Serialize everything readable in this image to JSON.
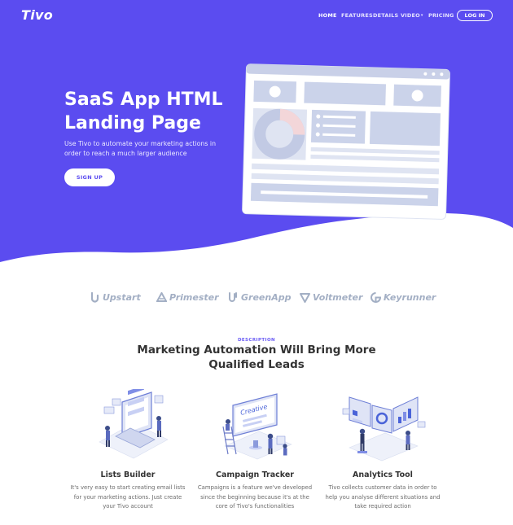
{
  "header": {
    "logo": "Tivo",
    "menu": [
      "HOME",
      "FEATURES",
      "DETAILS",
      "VIDEO",
      "PRICING"
    ],
    "login_label": "LOG IN"
  },
  "hero": {
    "title": "SaaS App HTML Landing Page",
    "subtitle": "Use Tivo to automate your marketing actions in order to reach a much larger audience",
    "signup_label": "SIGN UP"
  },
  "brands": [
    "Upstart",
    "Primester",
    "GreenApp",
    "Voltmeter",
    "Keyrunner"
  ],
  "description": {
    "label": "DESCRIPTION",
    "title": "Marketing Automation Will Bring More Qualified Leads"
  },
  "features": [
    {
      "title": "Lists Builder",
      "text": "It's very easy to start creating email lists for your marketing actions. Just create your Tivo account"
    },
    {
      "title": "Campaign Tracker",
      "text": "Campaigns is a feature we've developed since the beginning because it's at the core of Tivo's functionalities"
    },
    {
      "title": "Analytics Tool",
      "text": "Tivo collects customer data in order to help you analyse different situations and take required action"
    }
  ],
  "illustration_labels": {
    "campaign_board": "Creative"
  },
  "colors": {
    "brand_purple": "#5b4cf0",
    "hero_text": "#ffffff",
    "brand_logo_gray": "#a3afc4",
    "heading_dark": "#333333",
    "body_gray": "#6b6b6b"
  }
}
